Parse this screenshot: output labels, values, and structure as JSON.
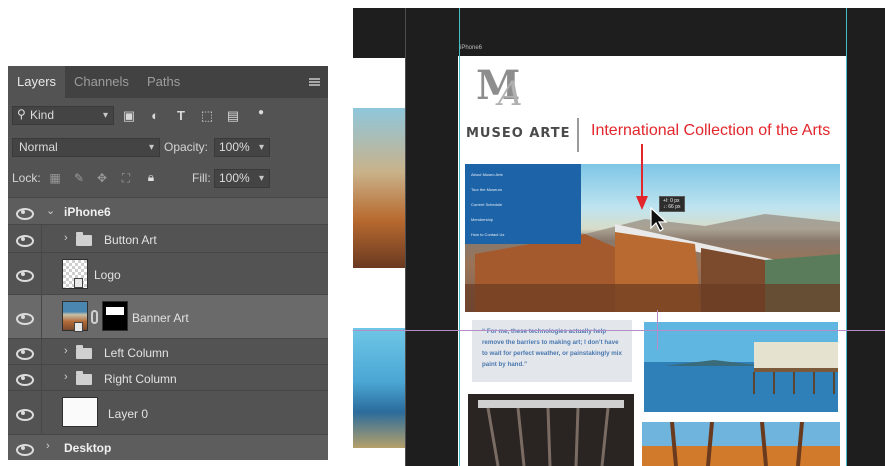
{
  "layers_panel": {
    "tabs": [
      "Layers",
      "Channels",
      "Paths"
    ],
    "filter": {
      "kind_label": "Kind"
    },
    "blend_mode": "Normal",
    "opacity_label": "Opacity:",
    "opacity_value": "100%",
    "lock_label": "Lock:",
    "fill_label": "Fill:",
    "fill_value": "100%",
    "layers": [
      {
        "name": "iPhone6",
        "type": "artboard",
        "expanded": true
      },
      {
        "name": "Button Art",
        "type": "group"
      },
      {
        "name": "Logo",
        "type": "smart-object"
      },
      {
        "name": "Banner Art",
        "type": "smart-object-with-mask",
        "selected": true
      },
      {
        "name": "Left Column",
        "type": "group"
      },
      {
        "name": "Right Column",
        "type": "group"
      },
      {
        "name": "Layer 0",
        "type": "pixel"
      },
      {
        "name": "Desktop",
        "type": "artboard",
        "expanded": false
      }
    ]
  },
  "canvas": {
    "artboard_label": "iPhone6",
    "logo_text": "MUSEO ARTE",
    "annotation": "International Collection of the Arts",
    "nav_items": [
      "About Museo Arte",
      "Tour the Museum",
      "Current Schedule",
      "Membership",
      "How to Contact Us"
    ],
    "tooltip_lines": [
      "+I: 0 px",
      "↓: 66 px"
    ],
    "quote": "“ For me, these technologies actually help remove the barriers to making art; I don’t have to wait for perfect weather, or painstakingly mix paint by hand.”",
    "colors": {
      "annotation_red": "#e2262c",
      "nav_blue": "#1d63a8",
      "quote_blue": "#4a78b0"
    }
  }
}
